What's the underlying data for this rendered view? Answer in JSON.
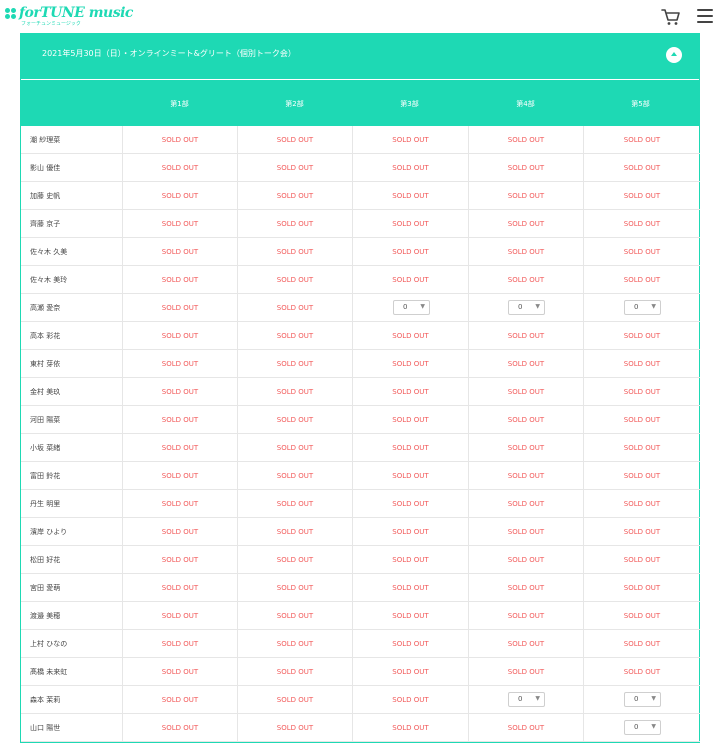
{
  "header": {
    "logo_text": "forTUNE music",
    "logo_sub": "フォーチュンミュージック",
    "cart_icon": "cart-icon",
    "menu_icon": "hamburger-menu-icon"
  },
  "colors": {
    "accent": "#1ed9b4",
    "sold_out": "#f25a5a"
  },
  "event": {
    "title": "2021年5月30日（日）・オンラインミート&グリート（個別トーク会）",
    "collapse_icon": "chevron-up-icon",
    "columns": [
      "第1部",
      "第2部",
      "第3部",
      "第4部",
      "第5部"
    ],
    "rows": [
      {
        "name": "潮 紗理菜",
        "slots": [
          "SOLD OUT",
          "SOLD OUT",
          "SOLD OUT",
          "SOLD OUT",
          "SOLD OUT"
        ]
      },
      {
        "name": "影山 優佳",
        "slots": [
          "SOLD OUT",
          "SOLD OUT",
          "SOLD OUT",
          "SOLD OUT",
          "SOLD OUT"
        ]
      },
      {
        "name": "加藤 史帆",
        "slots": [
          "SOLD OUT",
          "SOLD OUT",
          "SOLD OUT",
          "SOLD OUT",
          "SOLD OUT"
        ]
      },
      {
        "name": "齊藤 京子",
        "slots": [
          "SOLD OUT",
          "SOLD OUT",
          "SOLD OUT",
          "SOLD OUT",
          "SOLD OUT"
        ]
      },
      {
        "name": "佐々木 久美",
        "slots": [
          "SOLD OUT",
          "SOLD OUT",
          "SOLD OUT",
          "SOLD OUT",
          "SOLD OUT"
        ]
      },
      {
        "name": "佐々木 美玲",
        "slots": [
          "SOLD OUT",
          "SOLD OUT",
          "SOLD OUT",
          "SOLD OUT",
          "SOLD OUT"
        ]
      },
      {
        "name": "高瀬 愛奈",
        "slots": [
          "SOLD OUT",
          "SOLD OUT",
          "0",
          "0",
          "0"
        ]
      },
      {
        "name": "高本 彩花",
        "slots": [
          "SOLD OUT",
          "SOLD OUT",
          "SOLD OUT",
          "SOLD OUT",
          "SOLD OUT"
        ]
      },
      {
        "name": "東村 芽依",
        "slots": [
          "SOLD OUT",
          "SOLD OUT",
          "SOLD OUT",
          "SOLD OUT",
          "SOLD OUT"
        ]
      },
      {
        "name": "金村 美玖",
        "slots": [
          "SOLD OUT",
          "SOLD OUT",
          "SOLD OUT",
          "SOLD OUT",
          "SOLD OUT"
        ]
      },
      {
        "name": "河田 陽菜",
        "slots": [
          "SOLD OUT",
          "SOLD OUT",
          "SOLD OUT",
          "SOLD OUT",
          "SOLD OUT"
        ]
      },
      {
        "name": "小坂 菜緒",
        "slots": [
          "SOLD OUT",
          "SOLD OUT",
          "SOLD OUT",
          "SOLD OUT",
          "SOLD OUT"
        ]
      },
      {
        "name": "富田 鈴花",
        "slots": [
          "SOLD OUT",
          "SOLD OUT",
          "SOLD OUT",
          "SOLD OUT",
          "SOLD OUT"
        ]
      },
      {
        "name": "丹生 明里",
        "slots": [
          "SOLD OUT",
          "SOLD OUT",
          "SOLD OUT",
          "SOLD OUT",
          "SOLD OUT"
        ]
      },
      {
        "name": "濱岸 ひより",
        "slots": [
          "SOLD OUT",
          "SOLD OUT",
          "SOLD OUT",
          "SOLD OUT",
          "SOLD OUT"
        ]
      },
      {
        "name": "松田 好花",
        "slots": [
          "SOLD OUT",
          "SOLD OUT",
          "SOLD OUT",
          "SOLD OUT",
          "SOLD OUT"
        ]
      },
      {
        "name": "宮田 愛萌",
        "slots": [
          "SOLD OUT",
          "SOLD OUT",
          "SOLD OUT",
          "SOLD OUT",
          "SOLD OUT"
        ]
      },
      {
        "name": "渡邉 美穂",
        "slots": [
          "SOLD OUT",
          "SOLD OUT",
          "SOLD OUT",
          "SOLD OUT",
          "SOLD OUT"
        ]
      },
      {
        "name": "上村 ひなの",
        "slots": [
          "SOLD OUT",
          "SOLD OUT",
          "SOLD OUT",
          "SOLD OUT",
          "SOLD OUT"
        ]
      },
      {
        "name": "髙橋 未来虹",
        "slots": [
          "SOLD OUT",
          "SOLD OUT",
          "SOLD OUT",
          "SOLD OUT",
          "SOLD OUT"
        ]
      },
      {
        "name": "森本 茉莉",
        "slots": [
          "SOLD OUT",
          "SOLD OUT",
          "SOLD OUT",
          "0",
          "0"
        ]
      },
      {
        "name": "山口 陽世",
        "slots": [
          "SOLD OUT",
          "SOLD OUT",
          "SOLD OUT",
          "SOLD OUT",
          "0"
        ]
      }
    ]
  }
}
